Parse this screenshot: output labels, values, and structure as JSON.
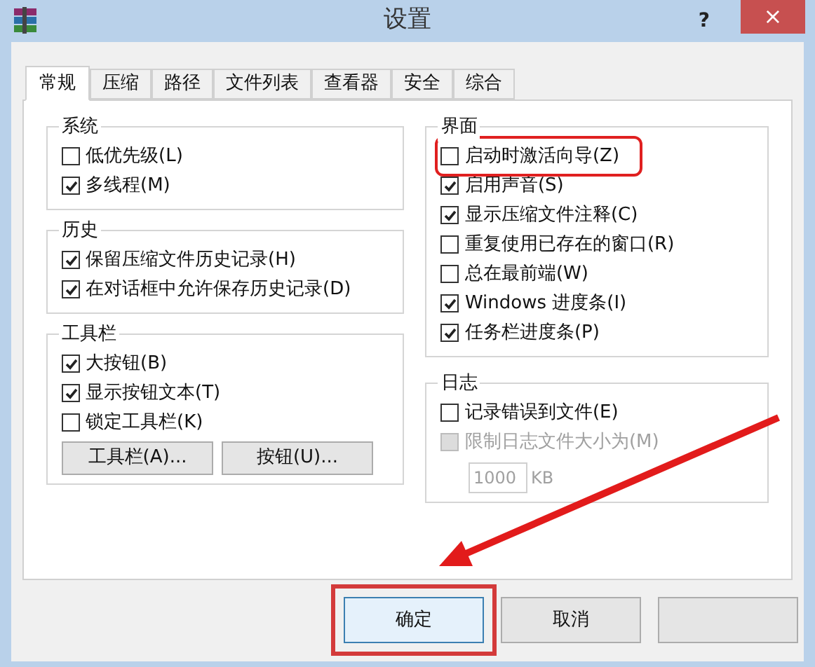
{
  "window": {
    "title": "设置",
    "help": "?",
    "close": "×"
  },
  "tabs": [
    {
      "label": "常规",
      "selected": true
    },
    {
      "label": "压缩",
      "selected": false
    },
    {
      "label": "路径",
      "selected": false
    },
    {
      "label": "文件列表",
      "selected": false
    },
    {
      "label": "查看器",
      "selected": false
    },
    {
      "label": "安全",
      "selected": false
    },
    {
      "label": "综合",
      "selected": false
    }
  ],
  "left_groups": [
    {
      "title": "系统",
      "items": [
        {
          "label": "低优先级(L)",
          "checked": false,
          "disabled": false
        },
        {
          "label": "多线程(M)",
          "checked": true,
          "disabled": false
        }
      ]
    },
    {
      "title": "历史",
      "items": [
        {
          "label": "保留压缩文件历史记录(H)",
          "checked": true,
          "disabled": false
        },
        {
          "label": "在对话框中允许保存历史记录(D)",
          "checked": true,
          "disabled": false
        }
      ]
    },
    {
      "title": "工具栏",
      "items": [
        {
          "label": "大按钮(B)",
          "checked": true,
          "disabled": false
        },
        {
          "label": "显示按钮文本(T)",
          "checked": true,
          "disabled": false
        },
        {
          "label": "锁定工具栏(K)",
          "checked": false,
          "disabled": false
        }
      ],
      "buttons": [
        "工具栏(A)...",
        "按钮(U)..."
      ]
    }
  ],
  "right_groups": [
    {
      "title": "界面",
      "items": [
        {
          "label": "启动时激活向导(Z)",
          "checked": false,
          "disabled": false,
          "highlighted": true
        },
        {
          "label": "启用声音(S)",
          "checked": true,
          "disabled": false
        },
        {
          "label": "显示压缩文件注释(C)",
          "checked": true,
          "disabled": false
        },
        {
          "label": "重复使用已存在的窗口(R)",
          "checked": false,
          "disabled": false
        },
        {
          "label": "总在最前端(W)",
          "checked": false,
          "disabled": false
        },
        {
          "label": "Windows 进度条(I)",
          "checked": true,
          "disabled": false
        },
        {
          "label": "任务栏进度条(P)",
          "checked": true,
          "disabled": false
        }
      ]
    },
    {
      "title": "日志",
      "items": [
        {
          "label": "记录错误到文件(E)",
          "checked": false,
          "disabled": false
        },
        {
          "label": "限制日志文件大小为(M)",
          "checked": false,
          "disabled": true
        }
      ],
      "size_field": {
        "value": "1000",
        "unit": "KB"
      }
    }
  ],
  "footer_buttons": [
    {
      "label": "确定",
      "highlighted": true
    },
    {
      "label": "取消",
      "highlighted": false
    }
  ]
}
